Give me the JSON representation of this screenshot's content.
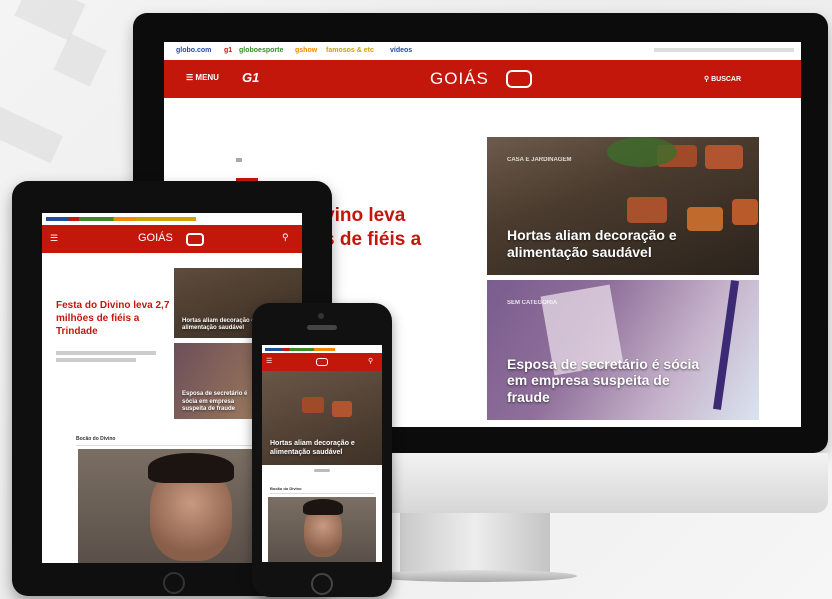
{
  "desktop": {
    "topnav": {
      "items": [
        {
          "label": "globo.com",
          "color": "#1f4e9d"
        },
        {
          "label": "g1",
          "color": "#c4170c"
        },
        {
          "label": "globoesporte",
          "color": "#3a8a2a"
        },
        {
          "label": "gshow",
          "color": "#f18a00"
        },
        {
          "label": "famosos & etc",
          "color": "#d4a000"
        },
        {
          "label": "vídeos",
          "color": "#1f4e9d"
        }
      ]
    },
    "header": {
      "menu_label": "MENU",
      "g1_logo": "G1",
      "region_title": "GOIÁS",
      "search_label": "BUSCAR"
    },
    "headline_partial": {
      "line1": "vino leva",
      "line2": "s de fiéis a"
    },
    "cards": [
      {
        "kicker": "CASA E JARDINAGEM",
        "title": "Hortas aliam decoração e alimentação saudável"
      },
      {
        "kicker": "SEM CATEGORIA",
        "title": "Esposa de secretário é sócia em empresa suspeita de fraude"
      }
    ]
  },
  "tablet": {
    "header": {
      "region_title": "GOIÁS"
    },
    "headline": "Festa do Divino leva 2,7 milhões de fiéis a Trindade",
    "cards": [
      {
        "title": "Hortas aliam decoração e alimentação saudável"
      },
      {
        "title": "Esposa de secretário é sócia em empresa suspeita de fraude"
      }
    ],
    "section_label": "Bocão do Divino"
  },
  "phone": {
    "card_title": "Hortas aliam decoração e alimentação saudável",
    "section_label": "Bocão do Divino"
  },
  "colors": {
    "brand_red": "#c4170c",
    "headline_red": "#c4170c"
  }
}
